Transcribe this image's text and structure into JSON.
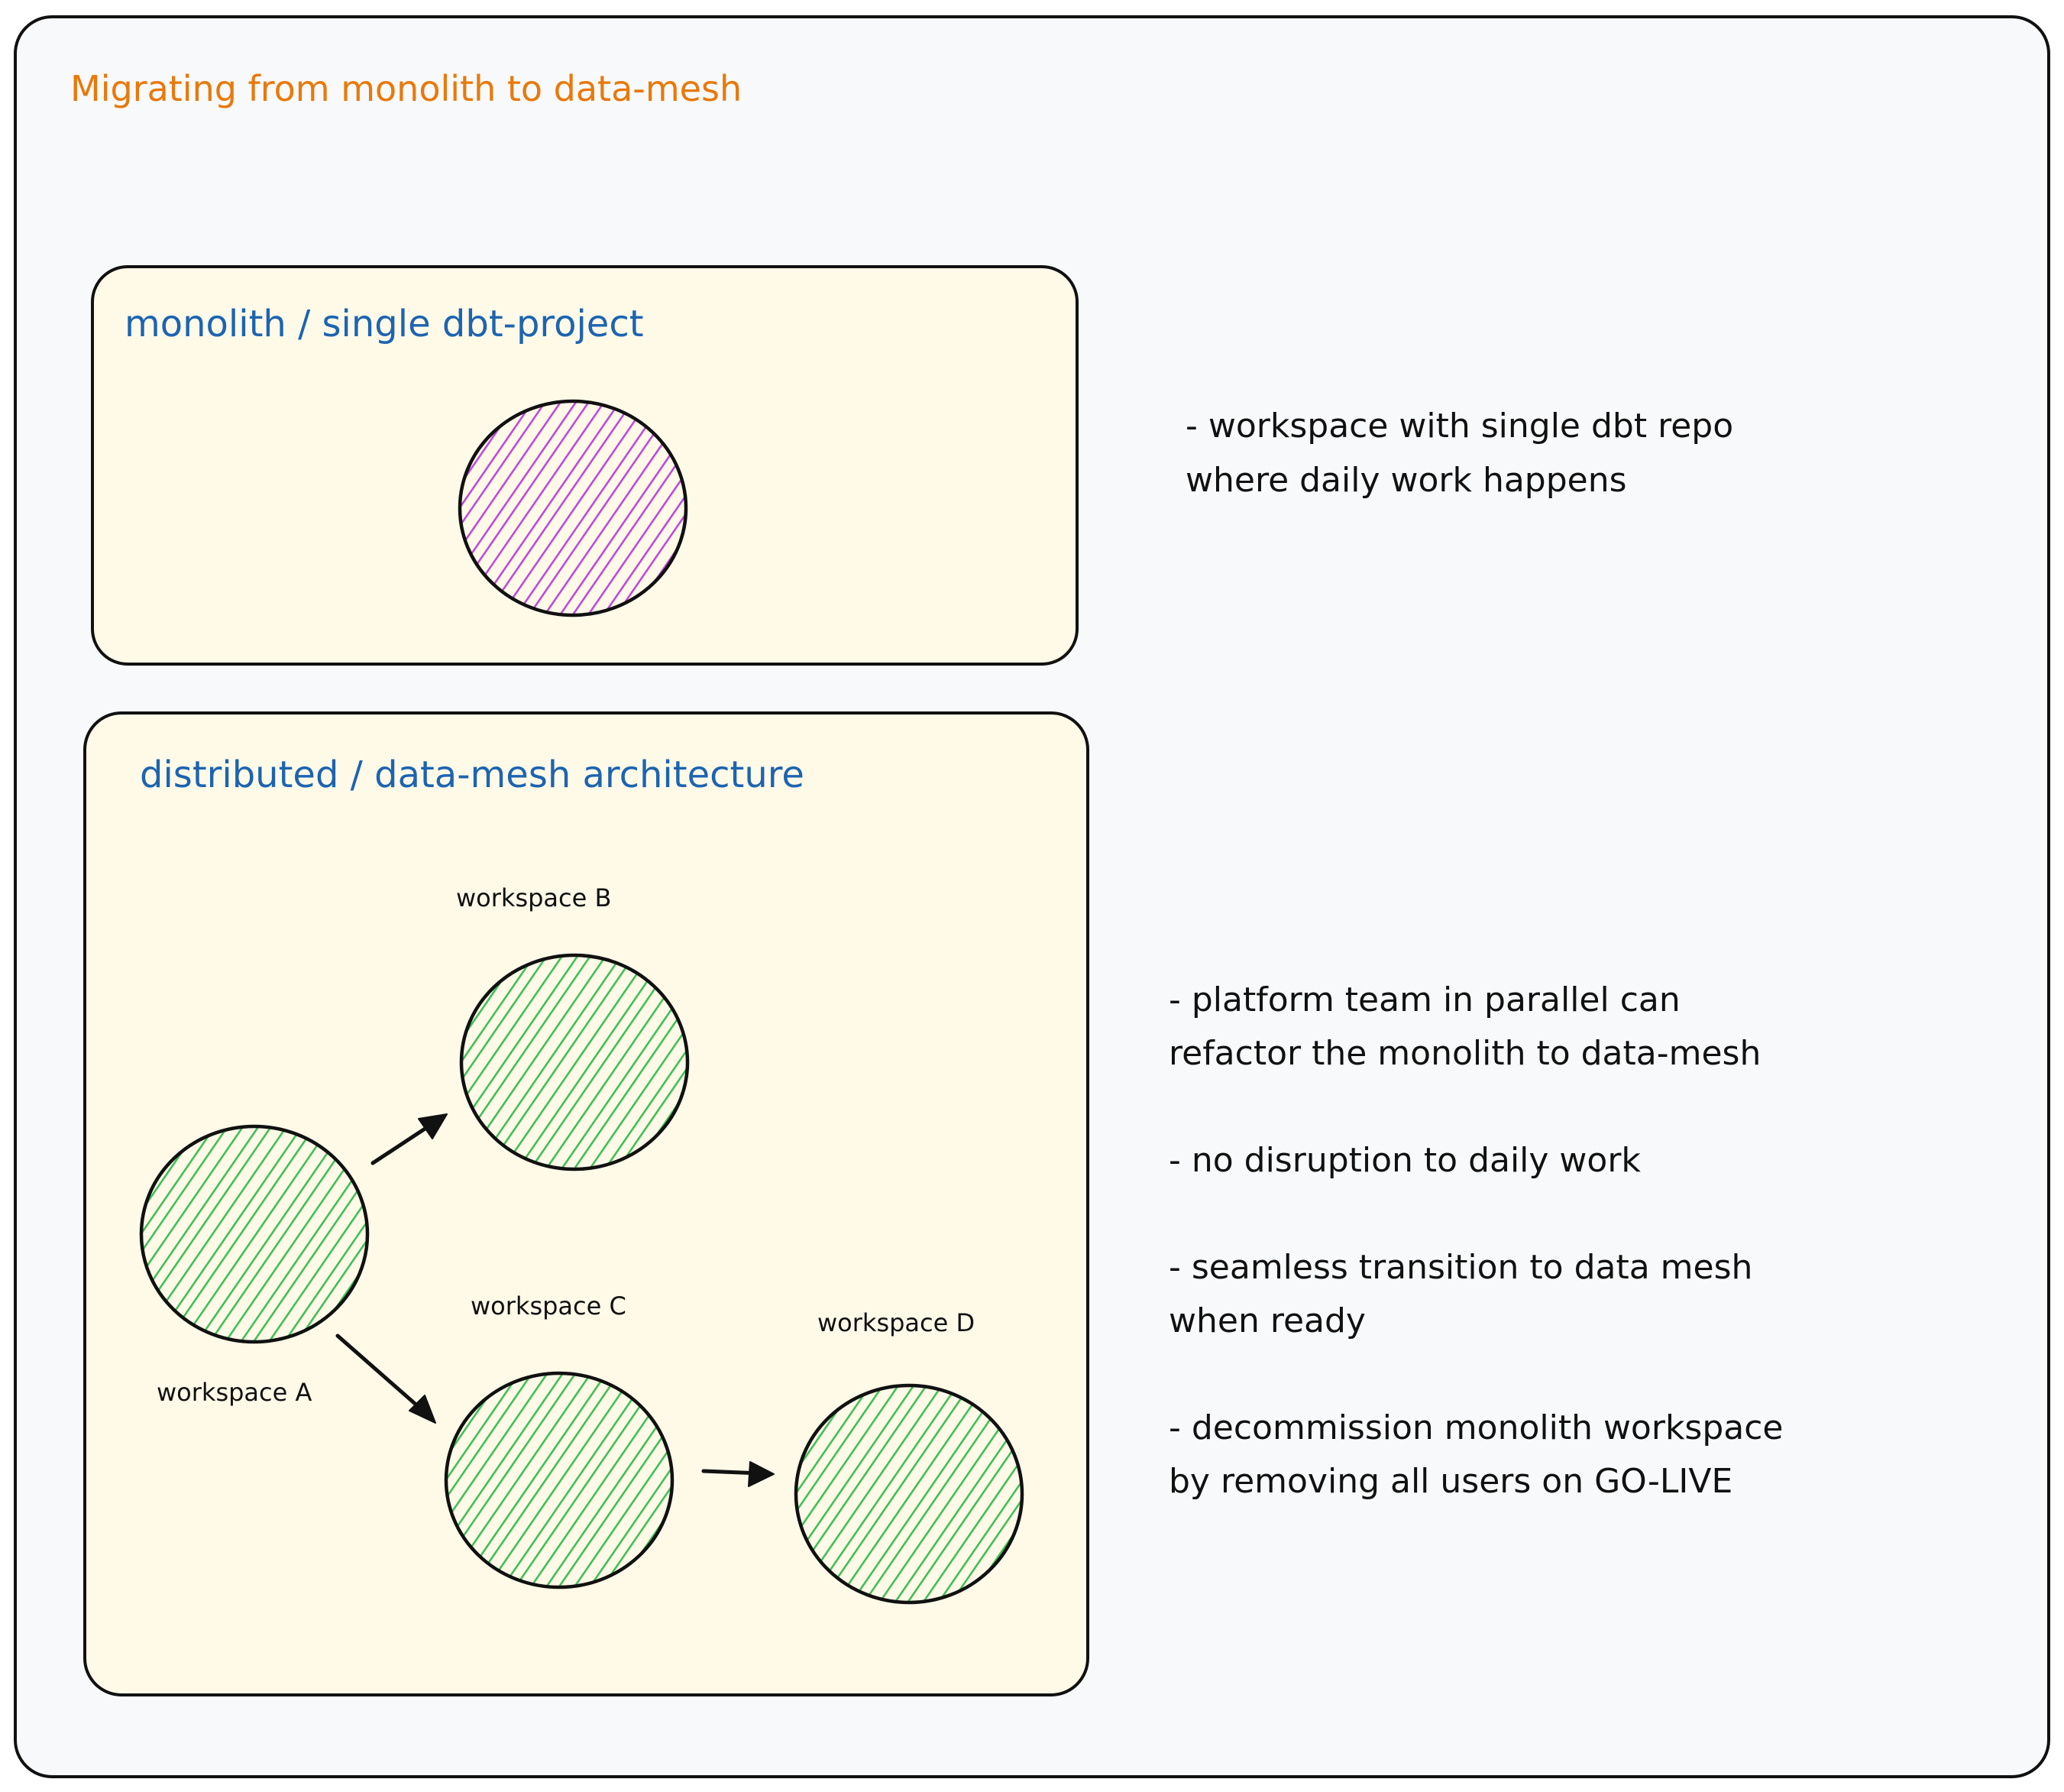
{
  "title": "Migrating from monolith to data-mesh",
  "colors": {
    "title": "#e8790a",
    "heading": "#1c64b0",
    "background": "#f8f9fa",
    "panel_fill": "#fff9e8",
    "stroke": "#111111",
    "monolith_hatch": "#be4bdb",
    "workspace_hatch": "#40c057"
  },
  "monolith_panel": {
    "heading": "monolith / single dbt-project",
    "node": {
      "id": "monolith",
      "label": "",
      "hatch": "purple"
    }
  },
  "mesh_panel": {
    "heading": "distributed / data-mesh architecture",
    "nodes": [
      {
        "id": "A",
        "label": "workspace A",
        "hatch": "green"
      },
      {
        "id": "B",
        "label": "workspace B",
        "hatch": "green"
      },
      {
        "id": "C",
        "label": "workspace C",
        "hatch": "green"
      },
      {
        "id": "D",
        "label": "workspace D",
        "hatch": "green"
      }
    ],
    "edges": [
      {
        "from": "A",
        "to": "B"
      },
      {
        "from": "A",
        "to": "C"
      },
      {
        "from": "C",
        "to": "D"
      }
    ]
  },
  "notes": {
    "monolith": [
      "- workspace with single dbt repo",
      "where daily work happens"
    ],
    "mesh": [
      [
        "- platform team in parallel can",
        "refactor the monolith to data-mesh"
      ],
      [
        "- no disruption to daily work"
      ],
      [
        "- seamless transition to data mesh",
        "when ready"
      ],
      [
        "- decommission monolith workspace",
        "by removing all users on GO-LIVE"
      ]
    ]
  }
}
